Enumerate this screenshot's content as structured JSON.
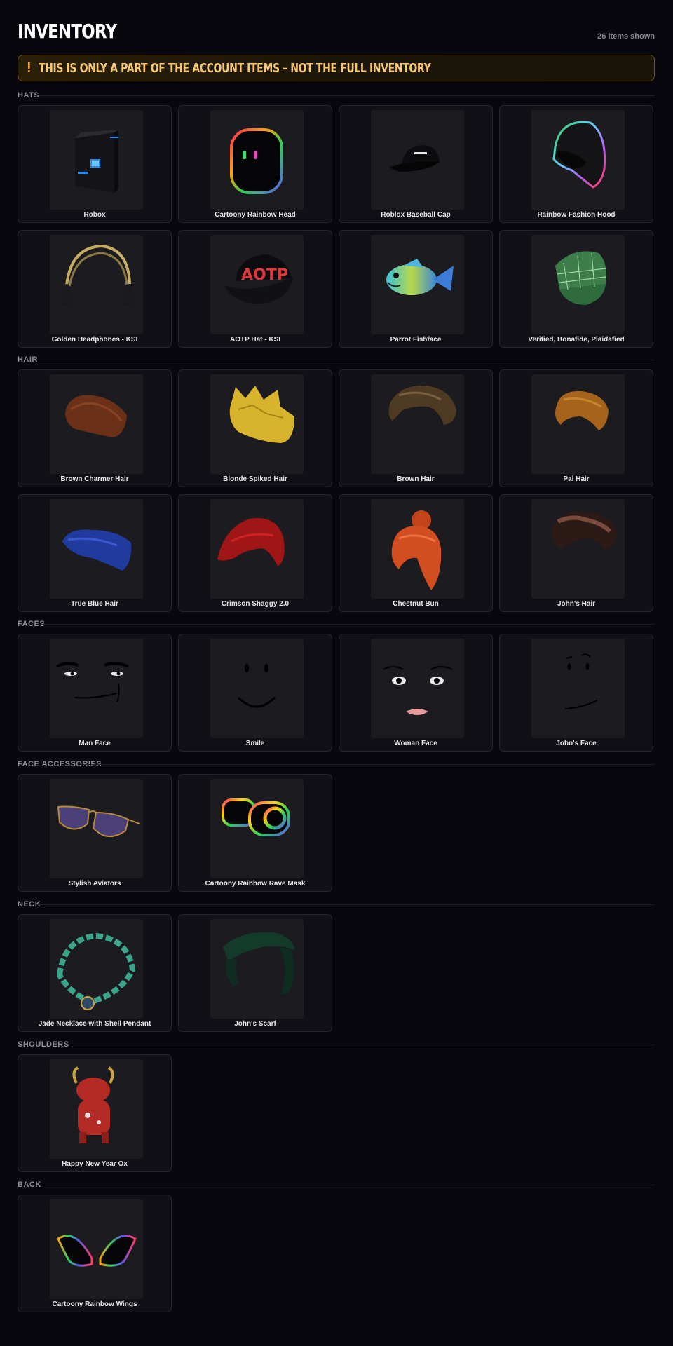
{
  "header": {
    "title": "INVENTORY",
    "count": "26 items shown"
  },
  "banner": {
    "icon": "!",
    "text": "THIS IS ONLY A PART OF THE ACCOUNT ITEMS – NOT THE FULL INVENTORY"
  },
  "sections": {
    "hats": {
      "label": "HATS",
      "items": [
        "Robox",
        "Cartoony Rainbow Head",
        "Roblox Baseball Cap",
        "Rainbow Fashion Hood",
        "Golden Headphones - KSI",
        "AOTP Hat - KSI",
        "Parrot Fishface",
        "Verified, Bonafide, Plaidafied"
      ]
    },
    "hair": {
      "label": "HAIR",
      "items": [
        "Brown Charmer Hair",
        "Blonde Spiked Hair",
        "Brown Hair",
        "Pal Hair",
        "True Blue Hair",
        "Crimson Shaggy 2.0",
        "Chestnut Bun",
        "John's Hair"
      ]
    },
    "faces": {
      "label": "FACES",
      "items": [
        "Man Face",
        "Smile",
        "Woman Face",
        "John's Face"
      ]
    },
    "face_accessories": {
      "label": "FACE ACCESSORIES",
      "items": [
        "Stylish Aviators",
        "Cartoony Rainbow Rave Mask"
      ]
    },
    "neck": {
      "label": "NECK",
      "items": [
        "Jade Necklace with Shell Pendant",
        "John's Scarf"
      ]
    },
    "shoulders": {
      "label": "SHOULDERS",
      "items": [
        "Happy New Year Ox"
      ]
    },
    "back": {
      "label": "BACK",
      "items": [
        "Cartoony Rainbow Wings"
      ]
    }
  },
  "icons": [
    "roblox-cube-icon",
    "rainbow-head-icon",
    "baseball-cap-icon",
    "rainbow-hood-icon",
    "headphones-icon",
    "aotp-hat-icon",
    "fish-icon",
    "plaid-cap-icon",
    "brown-hair-icon",
    "blonde-hair-icon",
    "brown-hair-icon",
    "pal-hair-icon",
    "blue-hair-icon",
    "crimson-hair-icon",
    "chestnut-bun-icon",
    "johns-hair-icon",
    "man-face-icon",
    "smile-face-icon",
    "woman-face-icon",
    "johns-face-icon",
    "aviators-icon",
    "rave-mask-icon",
    "jade-necklace-icon",
    "scarf-icon",
    "ox-icon",
    "rainbow-wings-icon"
  ],
  "colors": {
    "background": "#07070d",
    "card": "#101016",
    "banner_text": "#f7c873",
    "banner_border": "#6b5220"
  }
}
